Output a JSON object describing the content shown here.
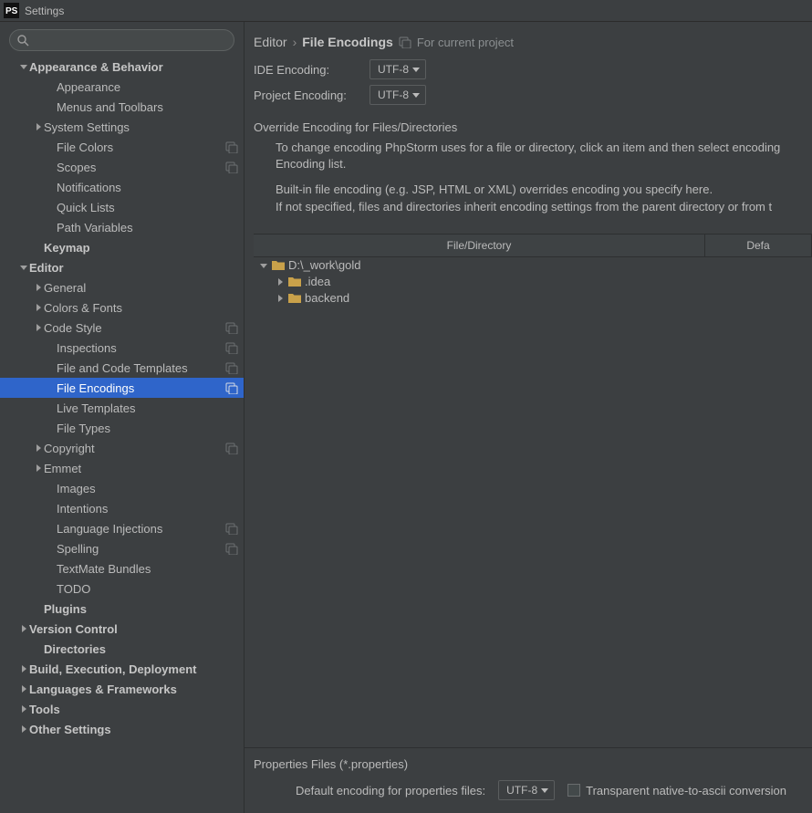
{
  "window": {
    "title": "Settings"
  },
  "search": {
    "placeholder": ""
  },
  "breadcrumb": {
    "root": "Editor",
    "leaf": "File Encodings",
    "scope": "For current project"
  },
  "ide_encoding": {
    "label": "IDE Encoding:",
    "value": "UTF-8"
  },
  "project_encoding": {
    "label": "Project Encoding:",
    "value": "UTF-8"
  },
  "override_title": "Override Encoding for Files/Directories",
  "help": {
    "p1": "To change encoding PhpStorm uses for a file or directory, click an item and then select encoding Encoding list.",
    "p2": "Built-in file encoding (e.g. JSP, HTML or XML) overrides encoding you specify here.",
    "p3": "If not specified, files and directories inherit encoding settings from the parent directory or from t"
  },
  "table": {
    "col1": "File/Directory",
    "col2": "Defa",
    "rows": [
      {
        "indent": 0,
        "expanded": true,
        "name": "D:\\_work\\gold"
      },
      {
        "indent": 1,
        "expanded": false,
        "name": ".idea"
      },
      {
        "indent": 1,
        "expanded": false,
        "name": "backend"
      }
    ]
  },
  "footer": {
    "title": "Properties Files (*.properties)",
    "default_label": "Default encoding for properties files:",
    "default_value": "UTF-8",
    "checkbox_label": "Transparent native-to-ascii conversion"
  },
  "sidebar": {
    "items": [
      {
        "lvl": 0,
        "arrow": "down",
        "bold": true,
        "label": "Appearance & Behavior"
      },
      {
        "lvl": 2,
        "arrow": "",
        "bold": false,
        "label": "Appearance"
      },
      {
        "lvl": 2,
        "arrow": "",
        "bold": false,
        "label": "Menus and Toolbars"
      },
      {
        "lvl": 1,
        "arrow": "right",
        "bold": false,
        "label": "System Settings"
      },
      {
        "lvl": 2,
        "arrow": "",
        "bold": false,
        "label": "File Colors",
        "badge": true
      },
      {
        "lvl": 2,
        "arrow": "",
        "bold": false,
        "label": "Scopes",
        "badge": true
      },
      {
        "lvl": 2,
        "arrow": "",
        "bold": false,
        "label": "Notifications"
      },
      {
        "lvl": 2,
        "arrow": "",
        "bold": false,
        "label": "Quick Lists"
      },
      {
        "lvl": 2,
        "arrow": "",
        "bold": false,
        "label": "Path Variables"
      },
      {
        "lvl": 1,
        "arrow": "",
        "bold": true,
        "label": "Keymap"
      },
      {
        "lvl": 0,
        "arrow": "down",
        "bold": true,
        "label": "Editor"
      },
      {
        "lvl": 1,
        "arrow": "right",
        "bold": false,
        "label": "General"
      },
      {
        "lvl": 1,
        "arrow": "right",
        "bold": false,
        "label": "Colors & Fonts"
      },
      {
        "lvl": 1,
        "arrow": "right",
        "bold": false,
        "label": "Code Style",
        "badge": true
      },
      {
        "lvl": 2,
        "arrow": "",
        "bold": false,
        "label": "Inspections",
        "badge": true
      },
      {
        "lvl": 2,
        "arrow": "",
        "bold": false,
        "label": "File and Code Templates",
        "badge": true
      },
      {
        "lvl": 2,
        "arrow": "",
        "bold": false,
        "label": "File Encodings",
        "badge": true,
        "selected": true
      },
      {
        "lvl": 2,
        "arrow": "",
        "bold": false,
        "label": "Live Templates"
      },
      {
        "lvl": 2,
        "arrow": "",
        "bold": false,
        "label": "File Types"
      },
      {
        "lvl": 1,
        "arrow": "right",
        "bold": false,
        "label": "Copyright",
        "badge": true
      },
      {
        "lvl": 1,
        "arrow": "right",
        "bold": false,
        "label": "Emmet"
      },
      {
        "lvl": 2,
        "arrow": "",
        "bold": false,
        "label": "Images"
      },
      {
        "lvl": 2,
        "arrow": "",
        "bold": false,
        "label": "Intentions"
      },
      {
        "lvl": 2,
        "arrow": "",
        "bold": false,
        "label": "Language Injections",
        "badge": true
      },
      {
        "lvl": 2,
        "arrow": "",
        "bold": false,
        "label": "Spelling",
        "badge": true
      },
      {
        "lvl": 2,
        "arrow": "",
        "bold": false,
        "label": "TextMate Bundles"
      },
      {
        "lvl": 2,
        "arrow": "",
        "bold": false,
        "label": "TODO"
      },
      {
        "lvl": 1,
        "arrow": "",
        "bold": true,
        "label": "Plugins"
      },
      {
        "lvl": 0,
        "arrow": "right",
        "bold": true,
        "label": "Version Control"
      },
      {
        "lvl": 1,
        "arrow": "",
        "bold": true,
        "label": "Directories"
      },
      {
        "lvl": 0,
        "arrow": "right",
        "bold": true,
        "label": "Build, Execution, Deployment"
      },
      {
        "lvl": 0,
        "arrow": "right",
        "bold": true,
        "label": "Languages & Frameworks"
      },
      {
        "lvl": 0,
        "arrow": "right",
        "bold": true,
        "label": "Tools"
      },
      {
        "lvl": 0,
        "arrow": "right",
        "bold": true,
        "label": "Other Settings"
      }
    ]
  }
}
